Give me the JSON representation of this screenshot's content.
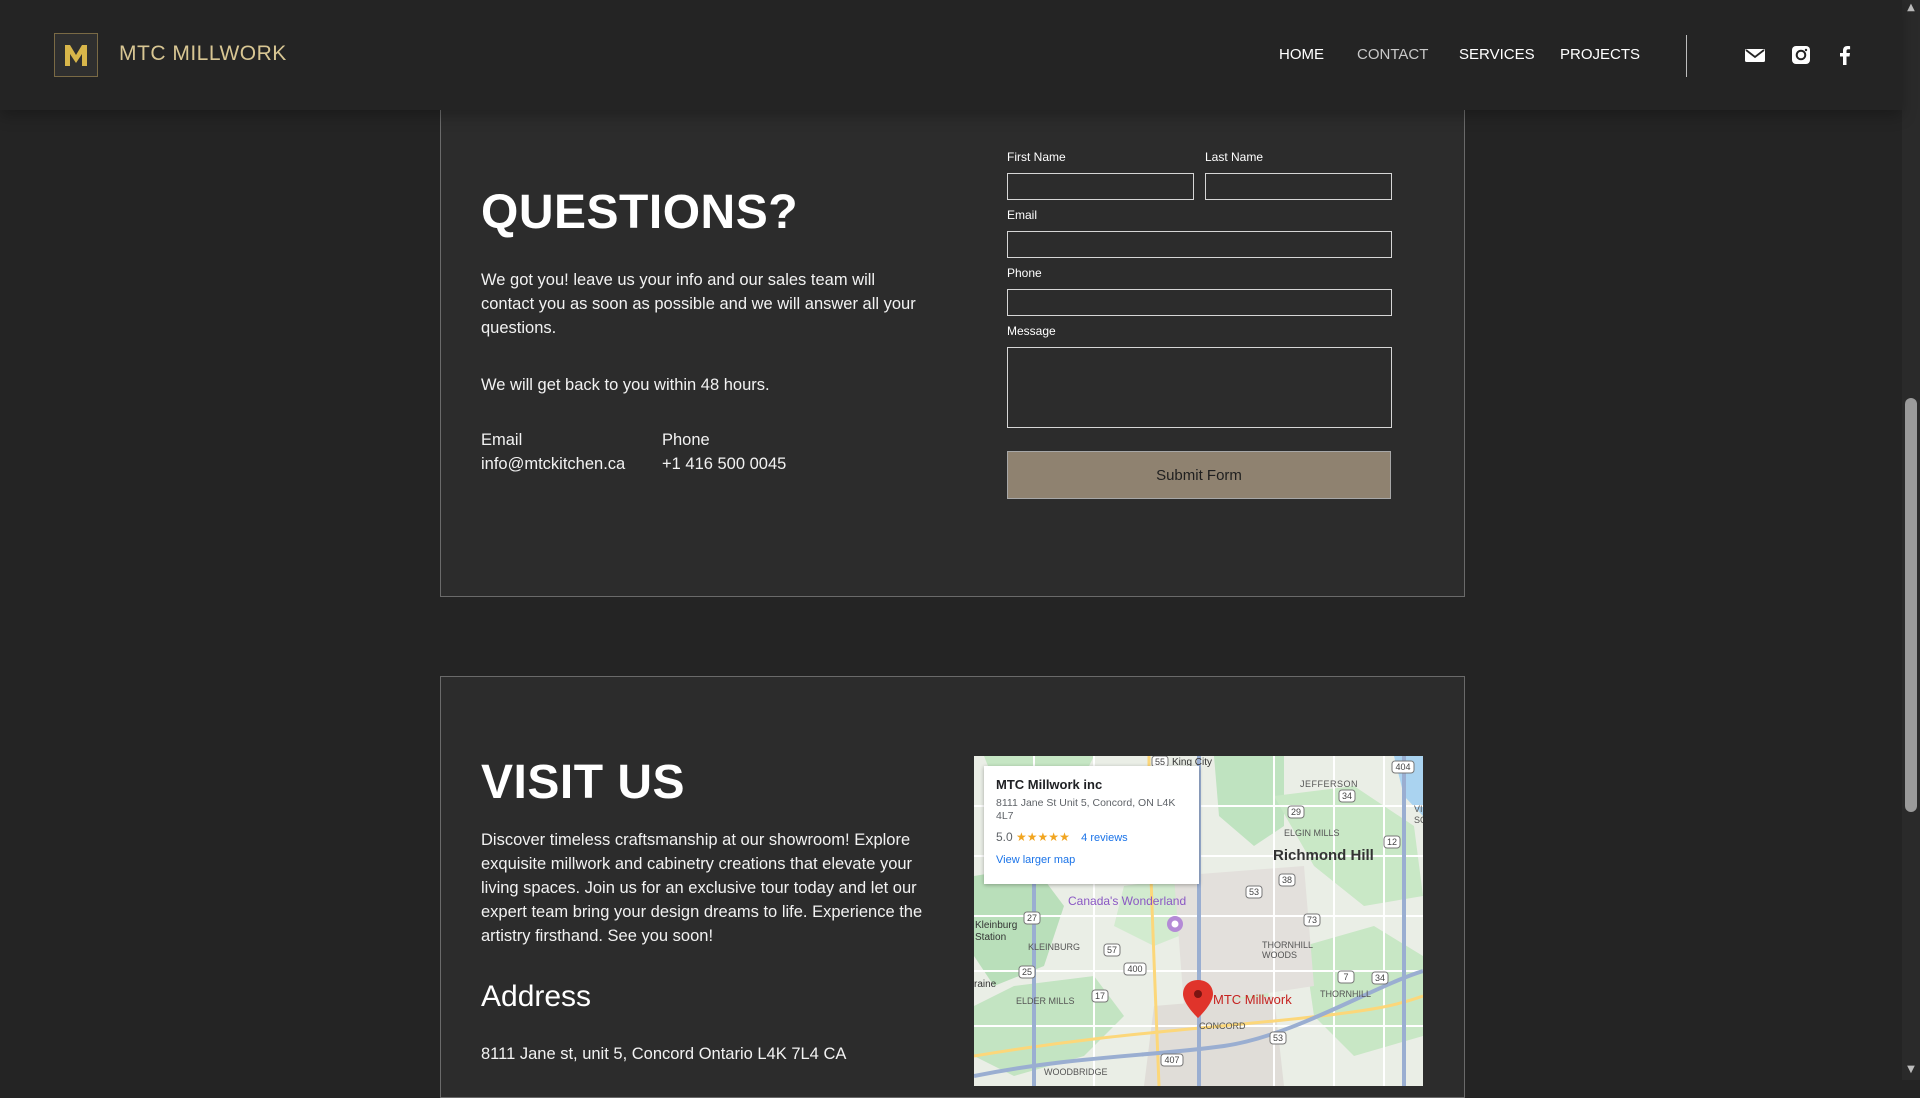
{
  "brand": {
    "name": "MTC MILLWORK",
    "logo_letter": "M",
    "gold": "#d8c693"
  },
  "nav": {
    "items": [
      {
        "label": "HOME",
        "active": false
      },
      {
        "label": "CONTACT",
        "active": true
      },
      {
        "label": "SERVICES",
        "active": false
      },
      {
        "label": "PROJECTS",
        "active": false
      }
    ],
    "social_icons": [
      "mail-icon",
      "instagram-icon",
      "facebook-icon"
    ]
  },
  "contact": {
    "title": "QUESTIONS?",
    "paragraph": "We got you! leave us your info and our sales team will contact you as soon as possible and we will answer all your questions.",
    "note": "We will get back to you within 48 hours.",
    "email_label": "Email",
    "email_value": "info@mtckitchen.ca",
    "phone_label": "Phone",
    "phone_value": "+1 416 500 0045"
  },
  "form": {
    "first_name_label": "First Name",
    "last_name_label": "Last Name",
    "email_label": "Email",
    "phone_label": "Phone",
    "message_label": "Message",
    "submit_label": "Submit Form",
    "submit_color": "#8f8270"
  },
  "visit": {
    "title": "VISIT US",
    "paragraph": "Discover timeless craftsmanship at our showroom! Explore exquisite millwork and cabinetry creations that elevate your living spaces. Join us for an exclusive tour today and let our expert team bring your design dreams to life. Experience the artistry firsthand. See you soon!",
    "address_heading": "Address",
    "address_value": "8111 Jane st, unit 5, Concord Ontario L4K 7L4 CA"
  },
  "map": {
    "card_title": "MTC Millwork inc",
    "card_address": "8111 Jane St Unit 5, Concord, ON L4K 4L7",
    "rating": "5.0",
    "stars": "★★★★★",
    "reviews": "4 reviews",
    "larger_map": "View larger map",
    "pin_label": "MTC Millwork",
    "places": {
      "king_city": "King City",
      "jefferson": "JEFFERSON",
      "elgin_mills": "ELGIN MILLS",
      "richmond_hill": "Richmond Hill",
      "vict": "VICT",
      "squ": "SQU",
      "canadas_wonderland": "Canada's Wonderland",
      "kleinburg_station": "Kleinburg Station",
      "kleinburg": "KLEINBURG",
      "thornhill_woods": "THORNHILL WOODS",
      "thornhill": "THORNHILL",
      "elder_mills": "ELDER MILLS",
      "concord": "CONCORD",
      "woodbridge": "WOODBRIDGE",
      "raine": "raine"
    },
    "route_shields": [
      "55",
      "404",
      "34",
      "29",
      "11",
      "12",
      "38",
      "53",
      "73",
      "27",
      "57",
      "25",
      "400",
      "17",
      "7",
      "34",
      "53",
      "407"
    ]
  }
}
